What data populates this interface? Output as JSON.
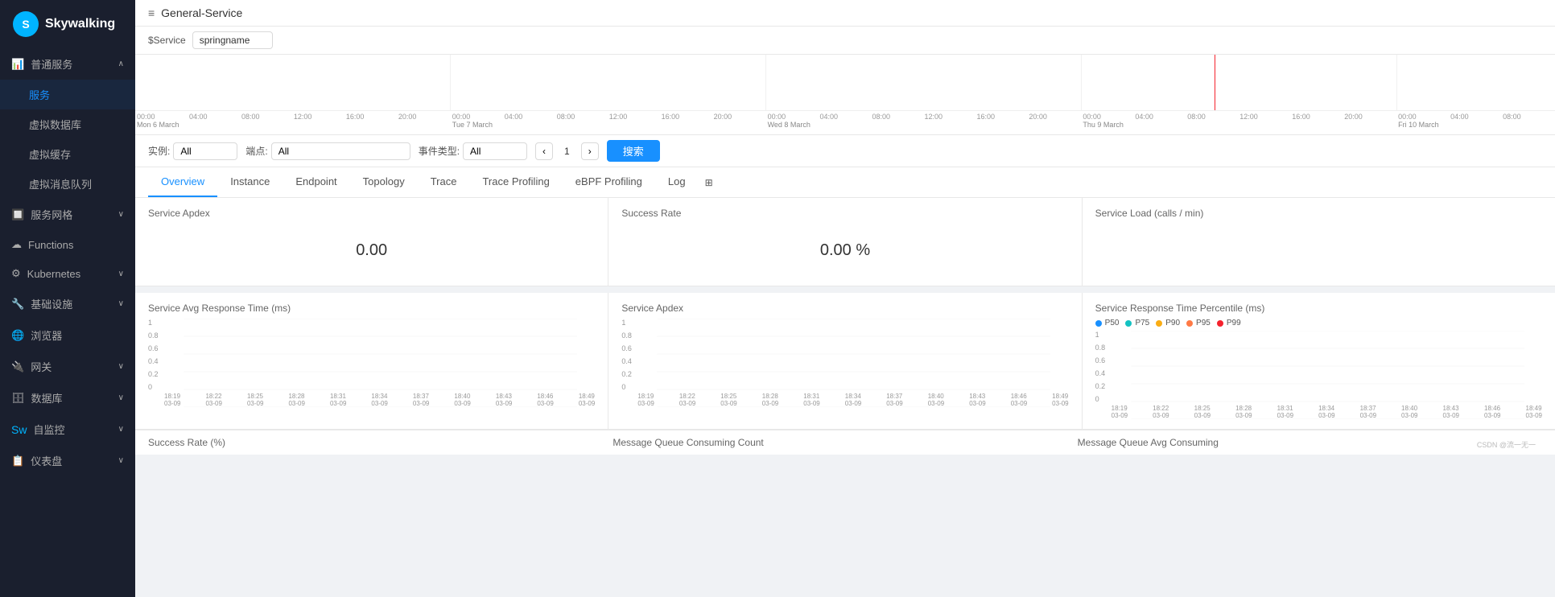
{
  "browser": {
    "title": "General-Service",
    "url": "192.168.11.100:8082/dashboard/GENERAL/Service/c3ByaW5nbmFtZQ==.1/General-Service"
  },
  "sidebar": {
    "logo": "Skywalking",
    "groups": [
      {
        "id": "general",
        "icon": "📊",
        "label": "普通服务",
        "expanded": true,
        "items": [
          {
            "id": "service",
            "label": "服务",
            "active": true
          },
          {
            "id": "virtual-db",
            "label": "虚拟数据库",
            "active": false
          },
          {
            "id": "virtual-cache",
            "label": "虚拟缓存",
            "active": false
          },
          {
            "id": "virtual-mq",
            "label": "虚拟消息队列",
            "active": false
          }
        ]
      },
      {
        "id": "service-mesh",
        "icon": "🔲",
        "label": "服务网格",
        "expanded": false,
        "items": []
      },
      {
        "id": "functions",
        "icon": "☁",
        "label": "Functions",
        "expanded": false,
        "items": []
      },
      {
        "id": "kubernetes",
        "icon": "⚙",
        "label": "Kubernetes",
        "expanded": false,
        "items": []
      },
      {
        "id": "infrastructure",
        "icon": "🔧",
        "label": "基础设施",
        "expanded": false,
        "items": []
      },
      {
        "id": "browser",
        "icon": "🌐",
        "label": "浏览器",
        "expanded": false,
        "items": []
      },
      {
        "id": "gateway",
        "icon": "🔌",
        "label": "网关",
        "expanded": false,
        "items": []
      },
      {
        "id": "database",
        "icon": "🗄",
        "label": "数据库",
        "expanded": false,
        "items": []
      },
      {
        "id": "self-monitor",
        "icon": "📡",
        "label": "自监控",
        "expanded": false,
        "items": []
      },
      {
        "id": "dashboard",
        "icon": "📋",
        "label": "仪表盘",
        "expanded": false,
        "items": []
      }
    ]
  },
  "header": {
    "icon": "≡",
    "title": "General-Service"
  },
  "service_filter": {
    "label": "$Service",
    "value": "springname"
  },
  "query": {
    "instance_label": "实例:",
    "instance_value": "All",
    "endpoint_label": "端点:",
    "endpoint_value": "All",
    "eventtype_label": "事件类型:",
    "eventtype_value": "All",
    "page": "1",
    "search_label": "搜索"
  },
  "timeline": {
    "sections": [
      {
        "times": [
          "00:00",
          "04:00",
          "08:00",
          "12:00",
          "16:00",
          "20:00"
        ],
        "date": "Mon 6 March"
      },
      {
        "times": [
          "00:00",
          "04:00",
          "08:00",
          "12:00",
          "16:00",
          "20:00"
        ],
        "date": "Tue 7 March"
      },
      {
        "times": [
          "00:00",
          "04:00",
          "08:00",
          "12:00",
          "16:00",
          "20:00"
        ],
        "date": "Wed 8 March"
      },
      {
        "times": [
          "00:00",
          "04:00",
          "08:00",
          "12:00",
          "16:00",
          "20:00"
        ],
        "date": "Thu 9 March"
      },
      {
        "times": [
          "00:00",
          "04:00",
          "08:00"
        ],
        "date": "Fri 10 March"
      }
    ]
  },
  "tabs": [
    {
      "id": "overview",
      "label": "Overview",
      "active": true
    },
    {
      "id": "instance",
      "label": "Instance",
      "active": false
    },
    {
      "id": "endpoint",
      "label": "Endpoint",
      "active": false
    },
    {
      "id": "topology",
      "label": "Topology",
      "active": false
    },
    {
      "id": "trace",
      "label": "Trace",
      "active": false
    },
    {
      "id": "trace-profiling",
      "label": "Trace Profiling",
      "active": false
    },
    {
      "id": "ebpf-profiling",
      "label": "eBPF Profiling",
      "active": false
    },
    {
      "id": "log",
      "label": "Log",
      "active": false
    }
  ],
  "panels": {
    "apdex": {
      "title": "Service Apdex",
      "value": "0.00"
    },
    "success_rate": {
      "title": "Success Rate",
      "value": "0.00 %"
    },
    "service_load": {
      "title": "Service Load (calls / min)",
      "value": ""
    }
  },
  "charts": {
    "avg_response": {
      "title": "Service Avg Response Time (ms)",
      "y_labels": [
        "1",
        "0.8",
        "0.6",
        "0.4",
        "0.2",
        "0"
      ],
      "x_labels": [
        "18:19\n03-09",
        "18:22\n03-09",
        "18:25\n03-09",
        "18:28\n03-09",
        "18:31\n03-09",
        "18:34\n03-09",
        "18:37\n03-09",
        "18:40\n03-09",
        "18:43\n03-09",
        "18:46\n03-09",
        "18:49\n03-09"
      ]
    },
    "service_apdex": {
      "title": "Service Apdex",
      "y_labels": [
        "1",
        "0.8",
        "0.6",
        "0.4",
        "0.2",
        "0"
      ],
      "x_labels": [
        "18:19\n03-09",
        "18:22\n03-09",
        "18:25\n03-09",
        "18:28\n03-09",
        "18:31\n03-09",
        "18:34\n03-09",
        "18:37\n03-09",
        "18:40\n03-09",
        "18:43\n03-09",
        "18:46\n03-09",
        "18:49\n03-09"
      ]
    },
    "response_percentile": {
      "title": "Service Response Time Percentile (ms)",
      "legend": [
        {
          "label": "P50",
          "color": "#1890ff"
        },
        {
          "label": "P75",
          "color": "#13c2c2"
        },
        {
          "label": "P90",
          "color": "#faad14"
        },
        {
          "label": "P95",
          "color": "#ff7a45"
        },
        {
          "label": "P99",
          "color": "#f5222d"
        }
      ],
      "y_labels": [
        "1",
        "0.8",
        "0.6",
        "0.4",
        "0.2",
        "0"
      ],
      "x_labels": [
        "18:19\n03-09",
        "18:22\n03-09",
        "18:25\n03-09",
        "18:28\n03-09",
        "18:31\n03-09",
        "18:34\n03-09",
        "18:37\n03-09",
        "18:40\n03-09",
        "18:43\n03-09",
        "18:46\n03-09",
        "18:49\n03-09"
      ]
    }
  },
  "bottom_row": {
    "success_rate_label": "Success Rate (%)",
    "mq_count_label": "Message Queue Consuming Count",
    "mq_avg_label": "Message Queue Avg Consuming"
  },
  "watermark": "CSDN @流一无一"
}
